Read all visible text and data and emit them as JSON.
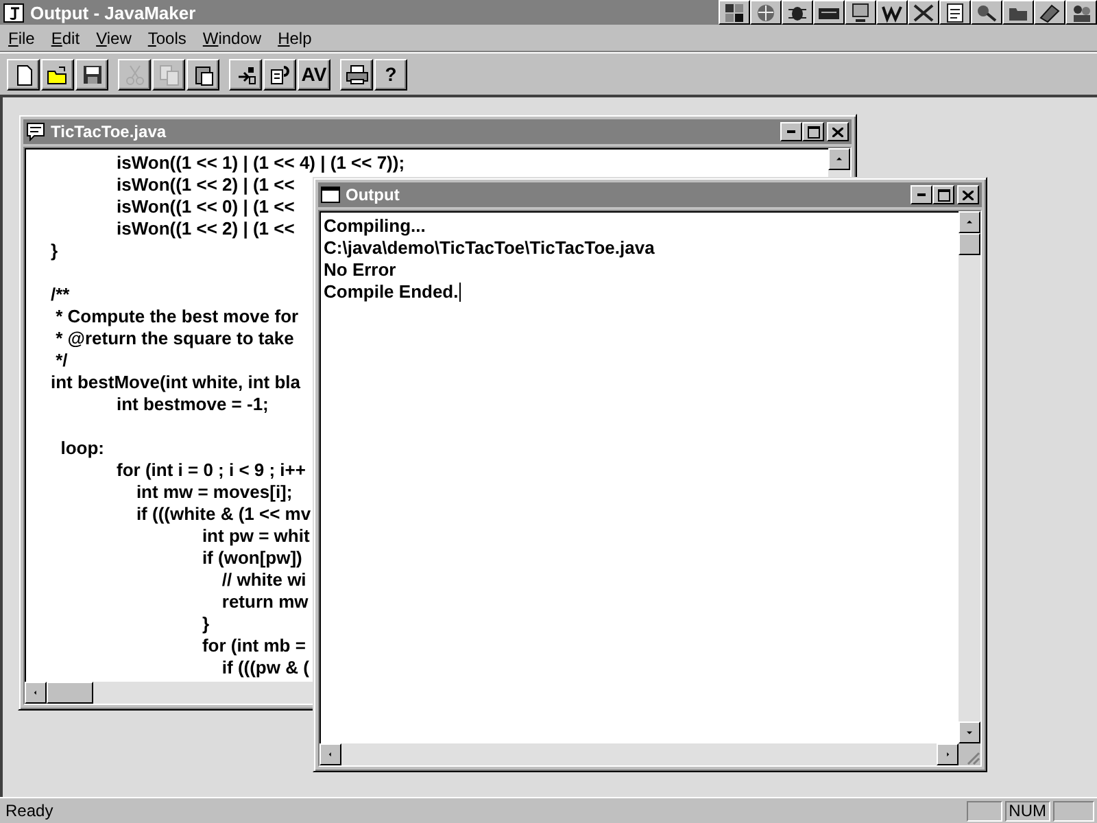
{
  "window": {
    "title": "Output - JavaMaker"
  },
  "menu": [
    {
      "label": "File"
    },
    {
      "label": "Edit"
    },
    {
      "label": "View"
    },
    {
      "label": "Tools"
    },
    {
      "label": "Window"
    },
    {
      "label": "Help"
    }
  ],
  "toolbar": {
    "groups": [
      [
        {
          "disabled": false
        },
        {
          "disabled": false
        },
        {
          "disabled": false
        }
      ],
      [
        {
          "disabled": true
        },
        {
          "disabled": true
        },
        {
          "disabled": false
        }
      ],
      [
        {
          "disabled": false
        },
        {
          "disabled": false
        },
        {
          "label": "AV",
          "disabled": false
        }
      ],
      [
        {
          "disabled": false
        },
        {
          "label": "?",
          "disabled": false
        }
      ]
    ]
  },
  "editor": {
    "title": "TicTacToe.java",
    "lines": [
      {
        "kind": "code",
        "text": "\tisWon((1 << 1) | (1 << 4) | (1 << 7));"
      },
      {
        "kind": "code",
        "text": "\tisWon((1 << 2) | (1 <<"
      },
      {
        "kind": "code",
        "text": "\tisWon((1 << 0) | (1 <<"
      },
      {
        "kind": "code",
        "text": "\tisWon((1 << 2) | (1 <<"
      },
      {
        "kind": "code",
        "text": "}"
      },
      {
        "kind": "blank"
      },
      {
        "kind": "code",
        "text": "/**"
      },
      {
        "kind": "code",
        "text": " * Compute the best move for"
      },
      {
        "kind": "code",
        "text": " * @return the square to take"
      },
      {
        "kind": "code",
        "text": " */"
      },
      {
        "kind": "code",
        "text": "int bestMove(int white, int bla"
      },
      {
        "kind": "code",
        "text": "\tint bestmove = -1;"
      },
      {
        "kind": "blank"
      },
      {
        "kind": "code",
        "text": "  loop:"
      },
      {
        "kind": "code",
        "text": "\tfor (int i = 0 ; i < 9 ; i++"
      },
      {
        "kind": "code",
        "text": "\t    int mw = moves[i];"
      },
      {
        "kind": "code",
        "text": "\t    if (((white & (1 << mv"
      },
      {
        "kind": "code",
        "text": "\t\t    int pw = whit"
      },
      {
        "kind": "code",
        "text": "\t\t    if (won[pw])"
      },
      {
        "kind": "code",
        "text": "\t\t        // white wi"
      },
      {
        "kind": "code",
        "text": "\t\t        return mw"
      },
      {
        "kind": "code",
        "text": "\t\t    }"
      },
      {
        "kind": "code",
        "text": "\t\t    for (int mb ="
      },
      {
        "kind": "code",
        "text": "\t\t        if (((pw & ("
      }
    ]
  },
  "output": {
    "title": "Output",
    "lines": [
      {
        "text": "Compiling...",
        "caret": false
      },
      {
        "text": "C:\\java\\demo\\TicTacToe\\TicTacToe.java",
        "caret": false
      },
      {
        "text": "No Error",
        "caret": false
      },
      {
        "text": "Compile Ended.",
        "caret": true
      }
    ]
  },
  "status_bar": {
    "message": "Ready",
    "indicators": [
      "NUM"
    ]
  }
}
